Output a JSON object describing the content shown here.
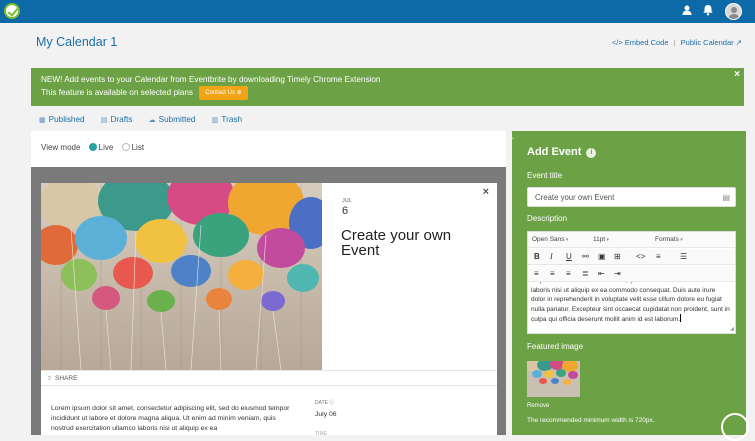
{
  "header": {
    "logo_icon": "timely-check-logo-icon",
    "user_icon": "user-icon",
    "bell_icon": "bell-icon",
    "avatar_icon": "avatar"
  },
  "page": {
    "title": "My Calendar 1",
    "embed_code": "</> Embed Code",
    "public_calendar": "Public Calendar ↗",
    "separator": "|"
  },
  "banner": {
    "line1": "NEW! Add events to your Calendar from Eventbrite by downloading Timely Chrome Extension",
    "line2": "This feature is available on selected plans",
    "contact_button": "Contact Us ⊕",
    "close": "×",
    "color": "#6ca146"
  },
  "tabs": [
    {
      "label": "Published",
      "icon": "calendar-icon"
    },
    {
      "label": "Drafts",
      "icon": "document-icon"
    },
    {
      "label": "Submitted",
      "icon": "cloud-icon"
    },
    {
      "label": "Trash",
      "icon": "trash-icon"
    }
  ],
  "view_mode": {
    "label": "View mode",
    "options": [
      "Live",
      "List"
    ],
    "selected": "Live"
  },
  "preview": {
    "close": "×",
    "month": "JUL",
    "day": "6",
    "title": "Create your own Event",
    "share": "SHARE",
    "description": "Lorem ipsum dolor sit amet, consectetur adipiscing elit, sed do eiusmod tempor incididunt ut labore et dolore magna aliqua. Ut enim ad minim veniam, quis nostrud exercitation ullamco laboris nisi ut aliquip ex ea",
    "date_label": "DATE",
    "date_value": "July 06",
    "time_label": "TIME"
  },
  "add_event": {
    "title": "Add Event",
    "event_title_label": "Event title",
    "event_title_placeholder": "Create your own Event",
    "description_label": "Description",
    "font_family": "Open Sans",
    "font_size": "11pt",
    "formats": "Formats",
    "editor_text": "aliqua. Ut enim ad minim veniam, quis nostrud exercitation ullamco laboris nisi ut aliquip ex ea commodo consequat. Duis aute irure dolor in reprehenderit in voluptate velit esse cillum dolore eu fugiat nulla pariatur. Excepteur sint occaecat cupidatat non proident, sunt in culpa qui officia deserunt mollit anim id est laborum.",
    "featured_image_label": "Featured image",
    "remove": "Remove",
    "min_width_note": "The recommended minimum width is 720px.",
    "panel_color": "#6ca146"
  }
}
